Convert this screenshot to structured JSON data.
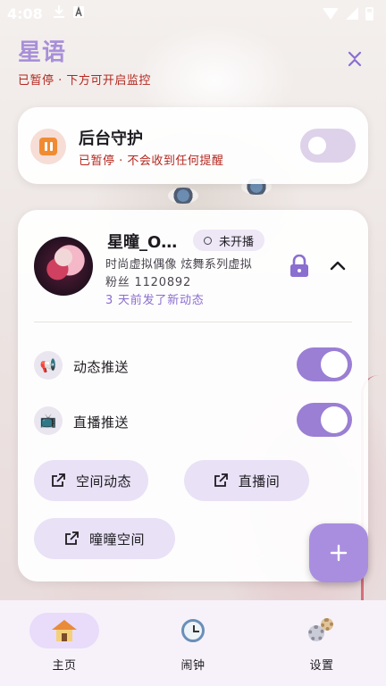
{
  "status_bar": {
    "time": "4:08",
    "icons": [
      "download-icon",
      "a-badge-icon",
      "wifi-icon",
      "signal-icon",
      "battery-icon"
    ]
  },
  "header": {
    "title": "星语",
    "subtitle": "已暂停 · 下方可开启监控",
    "collapse_icon": "chevrons-collapse-icon"
  },
  "guard": {
    "title": "后台守护",
    "subtitle": "已暂停 · 不会收到任何提醒",
    "enabled": false,
    "icon": "pause-icon"
  },
  "streamer": {
    "name": "星曈_O…",
    "live_status": "未开播",
    "description": "时尚虚拟偶像 炫舞系列虚拟",
    "fans": "粉丝 1120892",
    "recent": "3 天前发了新动态",
    "locked": true,
    "expanded": true
  },
  "settings": [
    {
      "label": "动态推送",
      "icon": "megaphone-icon",
      "glyph": "📢",
      "enabled": true
    },
    {
      "label": "直播推送",
      "icon": "tv-icon",
      "glyph": "📺",
      "enabled": true
    }
  ],
  "links": [
    {
      "label": "空间动态",
      "icon": "open-external-icon"
    },
    {
      "label": "直播间",
      "icon": "open-external-icon"
    },
    {
      "label": "曈曈空间",
      "icon": "open-external-icon"
    }
  ],
  "fab": {
    "icon": "plus-icon"
  },
  "bottom_nav": [
    {
      "label": "主页",
      "icon": "home-icon",
      "active": true
    },
    {
      "label": "闹钟",
      "icon": "alarm-clock-icon",
      "active": false
    },
    {
      "label": "设置",
      "icon": "gears-icon",
      "active": false
    }
  ],
  "colors": {
    "accent": "#a88fd8",
    "toggle_on": "#9a7fd4",
    "warning_text": "#b3261e",
    "chip_bg": "#e9e1f6"
  }
}
